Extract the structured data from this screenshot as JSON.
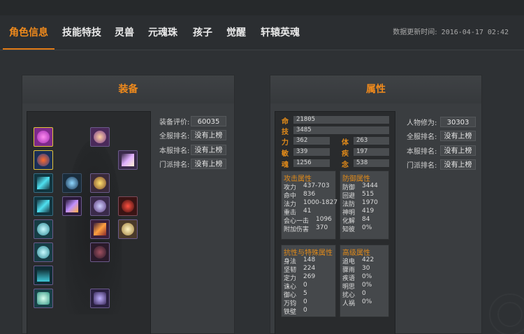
{
  "tabs": [
    {
      "label": "角色信息",
      "active": true
    },
    {
      "label": "技能特技"
    },
    {
      "label": "灵兽"
    },
    {
      "label": "元魂珠"
    },
    {
      "label": "孩子"
    },
    {
      "label": "觉醒"
    },
    {
      "label": "轩辕英魂"
    }
  ],
  "update": {
    "label": "数据更新时间:",
    "time": "2016-04-17 02:42"
  },
  "equip": {
    "title": "装备",
    "rating_label": "装备评价:",
    "rating_value": "60035",
    "rows": [
      {
        "label": "全服排名:",
        "value": "没有上榜"
      },
      {
        "label": "本服排名:",
        "value": "没有上榜"
      },
      {
        "label": "门派排名:",
        "value": "没有上榜"
      }
    ]
  },
  "attr": {
    "title": "属性",
    "cultivation_label": "人物修为:",
    "cultivation_value": "30303",
    "rows": [
      {
        "label": "全服排名:",
        "value": "没有上榜"
      },
      {
        "label": "本服排名:",
        "value": "没有上榜"
      },
      {
        "label": "门派排名:",
        "value": "没有上榜"
      }
    ],
    "core": [
      {
        "label": "命",
        "value": "21805"
      },
      {
        "label": "技",
        "value": "3485"
      }
    ],
    "pairs": [
      {
        "l1": "力",
        "v1": "362",
        "l2": "体",
        "v2": "263"
      },
      {
        "l1": "敏",
        "v1": "339",
        "l2": "疾",
        "v2": "197"
      },
      {
        "l1": "魂",
        "v1": "1256",
        "l2": "念",
        "v2": "538"
      }
    ],
    "attack": {
      "title": "攻击属性",
      "rows": [
        {
          "k": "攻力",
          "v": "437-703"
        },
        {
          "k": "命中",
          "v": "836"
        },
        {
          "k": "法力",
          "v": "1000-1827"
        },
        {
          "k": "重击",
          "v": "41"
        },
        {
          "k": "会心一击",
          "v": "1096"
        },
        {
          "k": "附加伤害",
          "v": "370"
        }
      ]
    },
    "defense": {
      "title": "防御属性",
      "rows": [
        {
          "k": "防御",
          "v": "3444"
        },
        {
          "k": "回避",
          "v": "515"
        },
        {
          "k": "法防",
          "v": "1970"
        },
        {
          "k": "神明",
          "v": "419"
        },
        {
          "k": "化解",
          "v": "84"
        },
        {
          "k": "知彼",
          "v": "0%"
        }
      ]
    },
    "resist": {
      "title": "抗性与特殊属性",
      "rows": [
        {
          "k": "身法",
          "v": "148"
        },
        {
          "k": "坚韧",
          "v": "224"
        },
        {
          "k": "定力",
          "v": "269"
        },
        {
          "k": "诛心",
          "v": "0"
        },
        {
          "k": "御心",
          "v": "5"
        },
        {
          "k": "万钧",
          "v": "0"
        },
        {
          "k": "铁壁",
          "v": "0"
        }
      ]
    },
    "advanced": {
      "title": "高级属性",
      "rows": [
        {
          "k": "追电",
          "v": "422"
        },
        {
          "k": "骤雨",
          "v": "30"
        },
        {
          "k": "疾语",
          "v": "0%"
        },
        {
          "k": "明思",
          "v": "0%"
        },
        {
          "k": "扰心",
          "v": "0"
        },
        {
          "k": "人祸",
          "v": "0%"
        }
      ]
    }
  },
  "colors": {
    "accent": "#f08a1c",
    "background": "#2e3134",
    "panel": "#3a3d40"
  }
}
